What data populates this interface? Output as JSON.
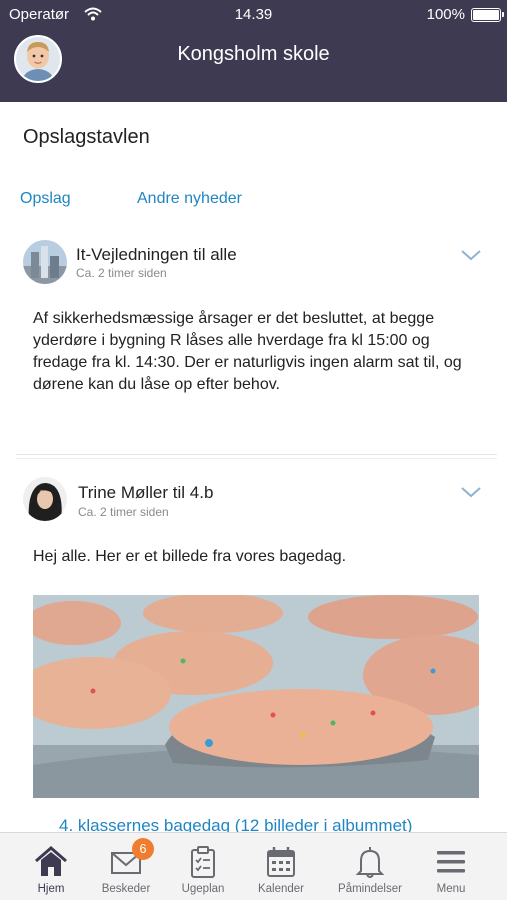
{
  "status_bar": {
    "carrier": "Operatør",
    "time": "14.39",
    "battery": "100%"
  },
  "header": {
    "title": "Kongsholm skole"
  },
  "page": {
    "title": "Opslagstavlen"
  },
  "tabs": [
    {
      "label": "Opslag"
    },
    {
      "label": "Andre nyheder"
    }
  ],
  "posts": [
    {
      "author": "It-Vejledningen til alle",
      "time": "Ca. 2 timer siden",
      "body": "Af sikkerhedsmæssige årsager er det besluttet, at begge yderdøre i bygning R låses alle hverdage fra kl 15:00 og fredage fra kl. 14:30. Der er naturligvis ingen alarm sat til, og dørene kan du låse op efter behov."
    },
    {
      "author": "Trine Møller til 4.b",
      "time": "Ca. 2 timer siden",
      "body": "Hej alle. Her er et billede fra vores bagedag.",
      "link": "4. klassernes bagedag (12 billeder i albummet)"
    }
  ],
  "nav": [
    {
      "label": "Hjem",
      "icon": "home-icon"
    },
    {
      "label": "Beskeder",
      "icon": "envelope-icon",
      "badge": "6"
    },
    {
      "label": "Ugeplan",
      "icon": "clipboard-icon"
    },
    {
      "label": "Kalender",
      "icon": "calendar-icon"
    },
    {
      "label": "Påmindelser",
      "icon": "bell-icon"
    },
    {
      "label": "Menu",
      "icon": "hamburger-icon"
    }
  ],
  "colors": {
    "header": "#3d3a52",
    "link": "#1f86c4",
    "badge": "#f07d2f"
  }
}
